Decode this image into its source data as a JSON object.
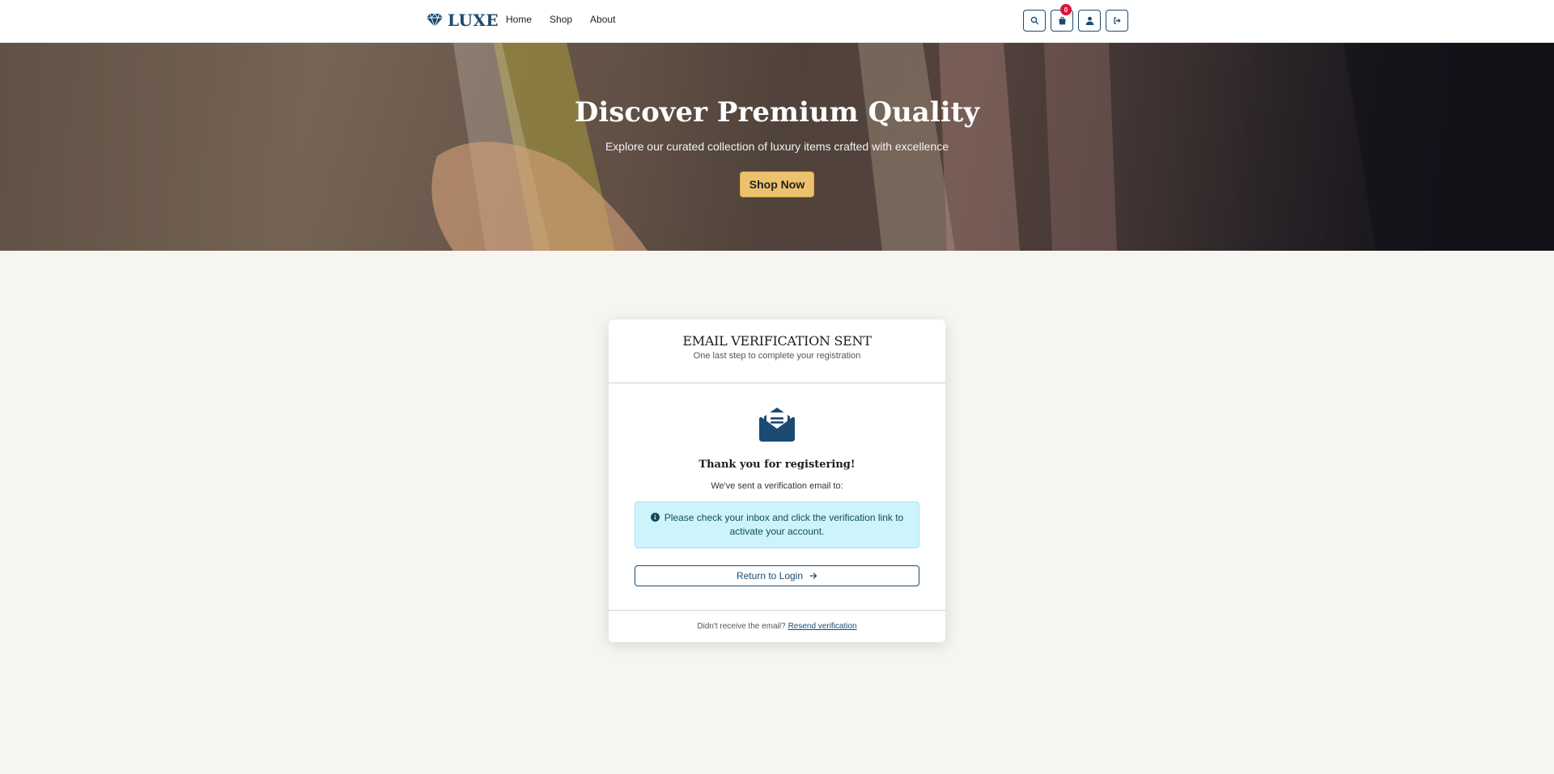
{
  "brand": {
    "name": "LUXE"
  },
  "nav": {
    "links": [
      {
        "label": "Home"
      },
      {
        "label": "Shop"
      },
      {
        "label": "About"
      }
    ],
    "icons": [
      {
        "name": "search-icon"
      },
      {
        "name": "shopping-bag-icon"
      },
      {
        "name": "user-icon"
      },
      {
        "name": "logout-icon"
      }
    ],
    "cart_count": "0"
  },
  "hero": {
    "title": "Discover Premium Quality",
    "subtitle": "Explore our curated collection of luxury items crafted with excellence",
    "cta_label": "Shop Now"
  },
  "verification": {
    "title": "EMAIL VERIFICATION SENT",
    "subtitle": "One last step to complete your registration",
    "heading": "Thank you for registering!",
    "sent_text": "We've sent a verification email to:",
    "alert_text": "Please check your inbox and click the verification link to activate your account.",
    "return_label": "Return to Login",
    "footer_text": "Didn't receive the email?",
    "resend_label": "Resend verification"
  },
  "colors": {
    "primary": "#1b4b72",
    "accent": "#edc26e",
    "badge": "#e0123b",
    "alert_bg": "#cdf4fb",
    "page_bg": "#f6f5f0"
  }
}
